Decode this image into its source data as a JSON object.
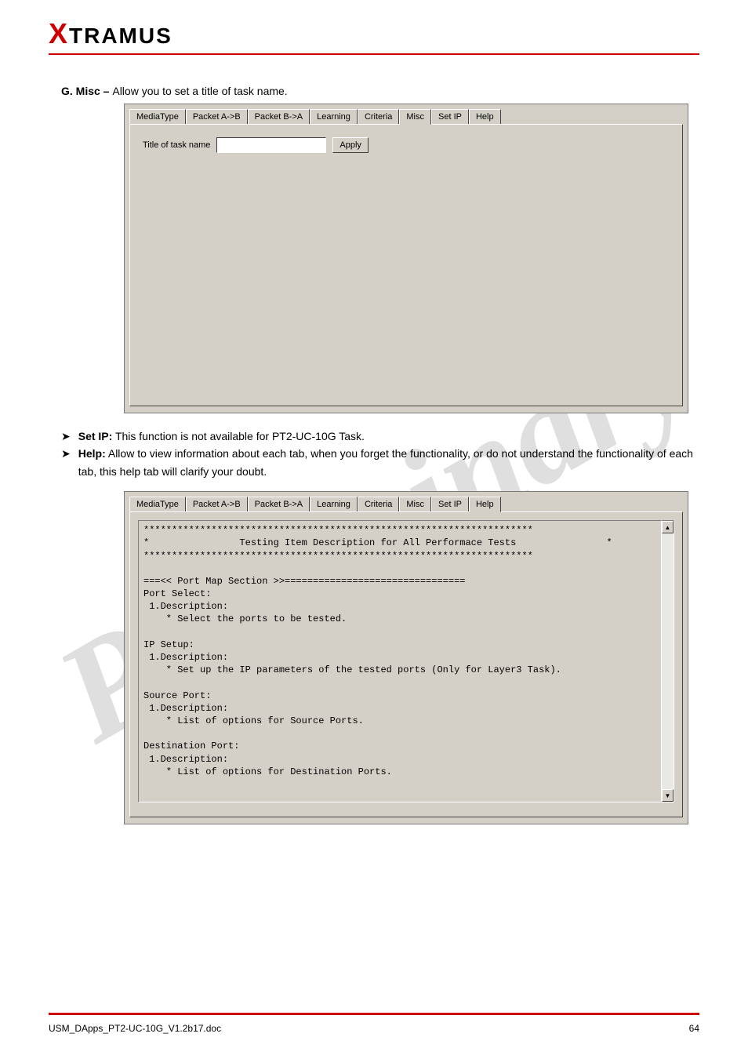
{
  "brand": {
    "name": "XTRAMUS"
  },
  "watermark": "Preliminary",
  "section_misc": {
    "heading_prefix": "G. Misc – ",
    "heading_rest": "Allow you to set a title of task name."
  },
  "tabs": [
    "MediaType",
    "Packet A->B",
    "Packet B->A",
    "Learning",
    "Criteria",
    "Misc",
    "Set IP",
    "Help"
  ],
  "misc_panel": {
    "active_tab": "Misc",
    "label": "Title of task name",
    "input_value": "",
    "apply": "Apply"
  },
  "bullets": [
    {
      "label": "Set IP:",
      "rest": " This function is not available for PT2-UC-10G Task."
    },
    {
      "label": "Help:",
      "rest": " Allow to view information about each tab, when you forget the functionality, or do not understand the functionality of each tab, this help tab will clarify your doubt."
    }
  ],
  "help_panel": {
    "active_tab": "Help",
    "text": "*********************************************************************\n*                Testing Item Description for All Performace Tests                *\n*********************************************************************\n\n===<< Port Map Section >>================================\nPort Select:\n 1.Description:\n    * Select the ports to be tested.\n\nIP Setup:\n 1.Description:\n    * Set up the IP parameters of the tested ports (Only for Layer3 Task).\n\nSource Port:\n 1.Description:\n    * List of options for Source Ports.\n\nDestination Port:\n 1.Description:\n    * List of options for Destination Ports."
  },
  "footer": {
    "left": "USM_DApps_PT2-UC-10G_V1.2b17.doc",
    "right": "64"
  }
}
